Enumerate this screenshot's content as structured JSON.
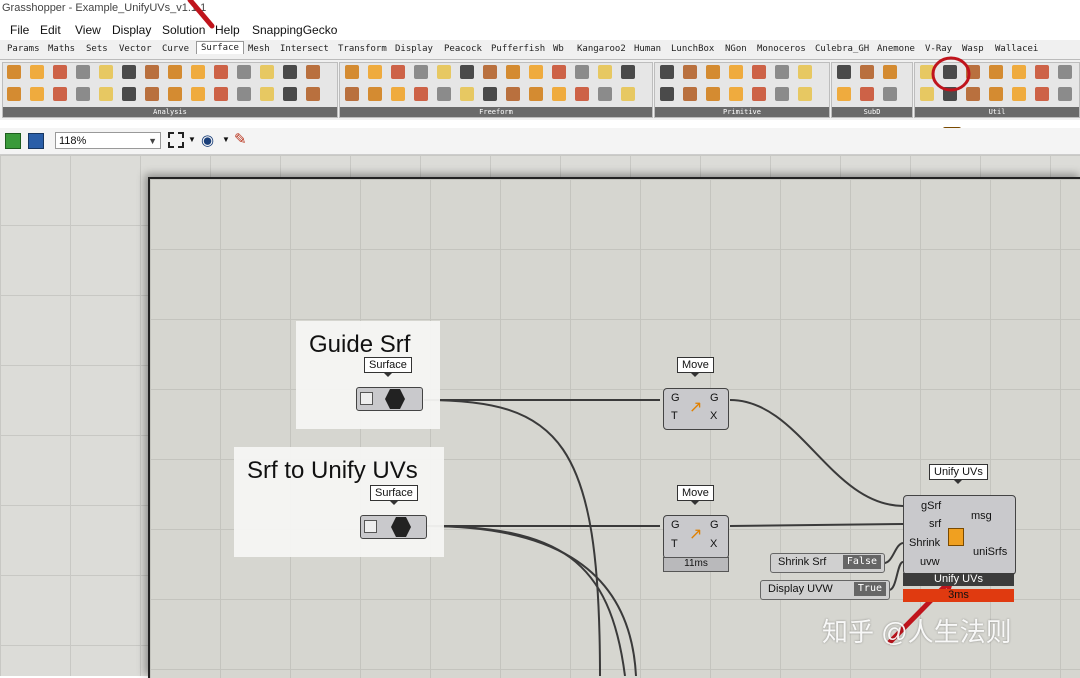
{
  "window": {
    "title": "Grasshopper - Example_UnifyUVs_v1.1.1"
  },
  "menu": [
    "File",
    "Edit",
    "View",
    "Display",
    "Solution",
    "Help",
    "SnappingGecko"
  ],
  "tabs": [
    "Params",
    "Maths",
    "Sets",
    "Vector",
    "Curve",
    "Surface",
    "Mesh",
    "Intersect",
    "Transform",
    "Display",
    "Peacock",
    "Pufferfish",
    "Wb",
    "Kangaroo2",
    "Human",
    "LunchBox",
    "NGon",
    "Monoceros",
    "Culebra_GH",
    "Anemone",
    "V-Ray",
    "Wasp",
    "Wallacei"
  ],
  "active_tab": "Surface",
  "ribbon_groups": [
    "Analysis",
    "Freeform",
    "Primitive",
    "SubD",
    "Util"
  ],
  "toolbar": {
    "zoom": "118%"
  },
  "canvas": {
    "groups": [
      {
        "title": "Guide Srf",
        "param_tag": "Surface"
      },
      {
        "title": "Srf to Unify UVs",
        "param_tag": "Surface"
      }
    ],
    "move1": {
      "tag": "Move",
      "inputs": [
        "G",
        "T"
      ],
      "outputs": [
        "G",
        "X"
      ]
    },
    "move2": {
      "tag": "Move",
      "inputs": [
        "G",
        "T"
      ],
      "outputs": [
        "G",
        "X"
      ],
      "time": "11ms"
    },
    "unify": {
      "tag": "Unify UVs",
      "inputs": [
        "gSrf",
        "srf",
        "Shrink",
        "uvw"
      ],
      "outputs": [
        "msg",
        "uniSrfs"
      ],
      "name": "Unify UVs",
      "time": "3ms"
    },
    "shrink_toggle": {
      "label": "Shrink Srf",
      "value": "False"
    },
    "uvw_toggle": {
      "label": "Display UVW",
      "value": "True"
    }
  },
  "watermark": "知乎 @人生法则",
  "colors": {
    "wire": "#3a3a3a",
    "annotation": "#c0141c",
    "error_bar": "#e03a10"
  }
}
